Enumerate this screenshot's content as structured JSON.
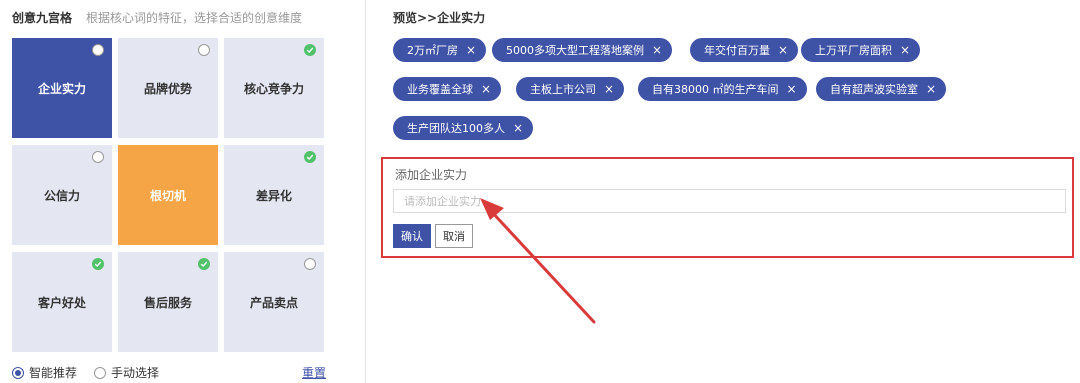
{
  "left": {
    "title": "创意九宫格",
    "hint": "根据核心词的特征，选择合适的创意维度",
    "grid": [
      {
        "label": "企业实力",
        "state": "selected",
        "mark": "empty"
      },
      {
        "label": "品牌优势",
        "state": "normal",
        "mark": "empty"
      },
      {
        "label": "核心竞争力",
        "state": "normal",
        "mark": "checked"
      },
      {
        "label": "公信力",
        "state": "normal",
        "mark": "empty"
      },
      {
        "label": "根切机",
        "state": "highlight",
        "mark": "none"
      },
      {
        "label": "差异化",
        "state": "normal",
        "mark": "checked"
      },
      {
        "label": "客户好处",
        "state": "normal",
        "mark": "checked"
      },
      {
        "label": "售后服务",
        "state": "normal",
        "mark": "checked"
      },
      {
        "label": "产品卖点",
        "state": "normal",
        "mark": "empty"
      }
    ],
    "mode_smart": "智能推荐",
    "mode_manual": "手动选择",
    "selected_mode": "smart",
    "reset": "重置"
  },
  "preview": {
    "title": "预览>>企业实力",
    "tags": [
      "2万㎡厂房",
      "5000多项大型工程落地案例",
      "年交付百万量",
      "上万平厂房面积",
      "业务覆盖全球",
      "主板上市公司",
      "自有38000 ㎡的生产车间",
      "自有超声波实验室",
      "生产团队达100多人"
    ],
    "remove_glyph": "×"
  },
  "form": {
    "label": "添加企业实力",
    "placeholder": "请添加企业实力",
    "value": "",
    "confirm": "确认",
    "cancel": "取消"
  },
  "colors": {
    "accent": "#3e52a6",
    "cell_bg": "#e4e7f2",
    "highlight": "#f5a446",
    "check": "#52c26a",
    "annotation_red": "#d93a3a"
  },
  "icons": {
    "check": "check-circle-icon",
    "radio": "radio-empty-icon",
    "remove": "close-icon",
    "annotation": "arrow-annotation-icon"
  }
}
